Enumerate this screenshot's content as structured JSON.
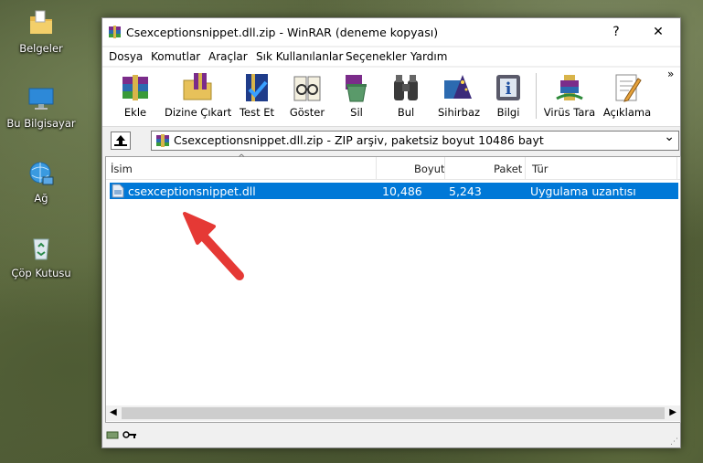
{
  "desktop": {
    "icons": [
      {
        "label": "Belgeler"
      },
      {
        "label": "Bu Bilgisayar"
      },
      {
        "label": "Ağ"
      },
      {
        "label": "Çöp Kutusu"
      }
    ]
  },
  "window": {
    "title": "Csexceptionsnippet.dll.zip - WinRAR (deneme kopyası)",
    "help_glyph": "?",
    "close_glyph": "✕"
  },
  "menu": {
    "items": [
      "Dosya",
      "Komutlar",
      "Araçlar",
      "Sık Kullanılanlar",
      "Seçenekler",
      "Yardım"
    ]
  },
  "toolbar": {
    "buttons": [
      {
        "label": "Ekle",
        "icon": "add-archive-icon"
      },
      {
        "label": "Dizine Çıkart",
        "icon": "extract-to-icon"
      },
      {
        "label": "Test Et",
        "icon": "test-icon"
      },
      {
        "label": "Göster",
        "icon": "view-icon"
      },
      {
        "label": "Sil",
        "icon": "delete-icon"
      },
      {
        "label": "Bul",
        "icon": "find-icon"
      },
      {
        "label": "Sihirbaz",
        "icon": "wizard-icon"
      },
      {
        "label": "Bilgi",
        "icon": "info-icon"
      },
      {
        "label": "Virüs Tara",
        "icon": "virus-scan-icon"
      },
      {
        "label": "Açıklama",
        "icon": "comment-icon"
      }
    ],
    "overflow_glyph": "»"
  },
  "address": {
    "path_text": "Csexceptionsnippet.dll.zip - ZIP arşiv, paketsiz boyut 10486 bayt",
    "dropdown_glyph": "⌄"
  },
  "file_list": {
    "columns": {
      "name": "İsim",
      "size": "Boyut",
      "packed": "Paket",
      "type": "Tür"
    },
    "sort_glyph": "^",
    "rows": [
      {
        "name": "csexceptionsnippet.dll",
        "size": "10,486",
        "packed": "5,243",
        "type": "Uygulama uzantısı",
        "selected": true
      }
    ]
  },
  "colors": {
    "selection": "#0078d7",
    "arrow": "#e53935"
  }
}
